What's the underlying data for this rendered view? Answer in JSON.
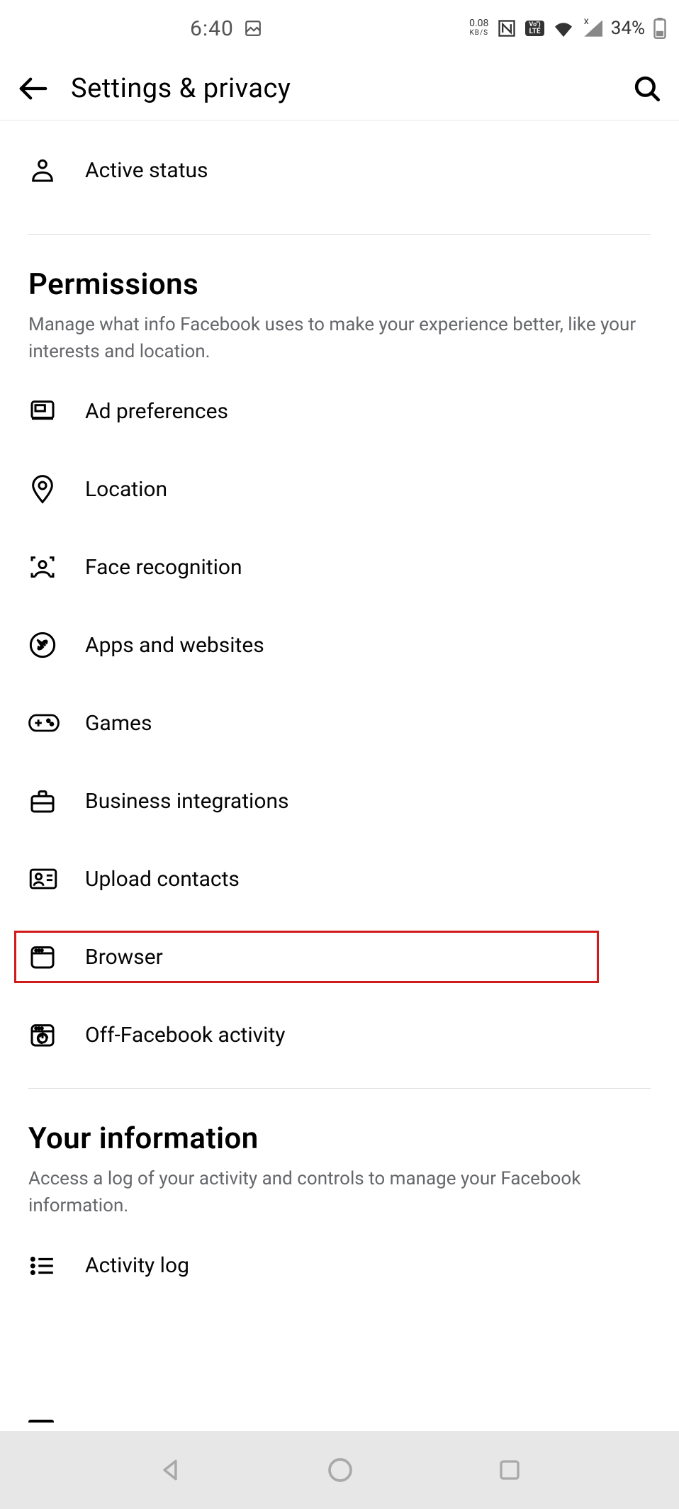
{
  "status_bar": {
    "time": "6:40",
    "net_speed_value": "0.08",
    "net_speed_unit": "KB/S",
    "volte_top": "Vo\")",
    "volte_bottom": "LTE",
    "signal_x": "x",
    "battery_pct": "34%"
  },
  "header": {
    "title": "Settings & privacy"
  },
  "top_items": [
    {
      "label": "Active status",
      "icon": "person-icon"
    }
  ],
  "sections": [
    {
      "title": "Permissions",
      "description": "Manage what info Facebook uses to make your experience better, like your interests and location.",
      "items": [
        {
          "label": "Ad preferences",
          "icon": "ad-icon",
          "name": "row-ad-preferences"
        },
        {
          "label": "Location",
          "icon": "location-icon",
          "name": "row-location"
        },
        {
          "label": "Face recognition",
          "icon": "face-recognition-icon",
          "name": "row-face-recognition"
        },
        {
          "label": "Apps and websites",
          "icon": "apps-websites-icon",
          "name": "row-apps-websites"
        },
        {
          "label": "Games",
          "icon": "games-icon",
          "name": "row-games"
        },
        {
          "label": "Business integrations",
          "icon": "briefcase-icon",
          "name": "row-business-integrations"
        },
        {
          "label": "Upload contacts",
          "icon": "contacts-icon",
          "name": "row-upload-contacts"
        },
        {
          "label": "Browser",
          "icon": "browser-icon",
          "name": "row-browser"
        },
        {
          "label": "Off-Facebook activity",
          "icon": "off-facebook-icon",
          "name": "row-off-facebook"
        }
      ]
    },
    {
      "title": "Your information",
      "description": "Access a log of your activity and controls to manage your Facebook information.",
      "items": [
        {
          "label": "Activity log",
          "icon": "activity-log-icon",
          "name": "row-activity-log"
        }
      ]
    }
  ],
  "highlight": {
    "target_name": "row-browser"
  }
}
